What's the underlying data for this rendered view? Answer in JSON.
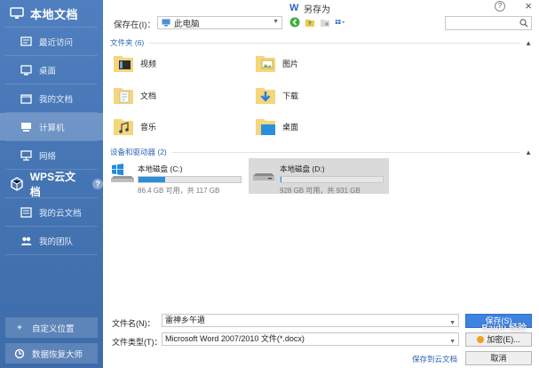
{
  "sidebar": {
    "local_docs_header": "本地文档",
    "local_items": [
      {
        "label": "最近访问",
        "icon": "recent-icon"
      },
      {
        "label": "桌面",
        "icon": "desktop-icon"
      },
      {
        "label": "我的文档",
        "icon": "documents-icon"
      },
      {
        "label": "计算机",
        "icon": "computer-icon"
      },
      {
        "label": "网络",
        "icon": "network-icon"
      }
    ],
    "cloud_header": "WPS云文档",
    "help_label": "?",
    "cloud_items": [
      {
        "label": "我的云文档",
        "icon": "cloud-doc-icon"
      },
      {
        "label": "我的团队",
        "icon": "team-icon"
      }
    ],
    "custom_location_button": "自定义位置",
    "data_recovery_button": "数据恢复大师"
  },
  "window": {
    "title": "另存为",
    "help_label": "?",
    "close_label": "×"
  },
  "location": {
    "label": "保存在(I)：",
    "value": "此电脑"
  },
  "content": {
    "folders_header": "文件夹 (6)",
    "folders": [
      {
        "label": "视频",
        "icon": "video-folder-icon"
      },
      {
        "label": "图片",
        "icon": "pictures-folder-icon"
      },
      {
        "label": "文档",
        "icon": "documents-folder-icon"
      },
      {
        "label": "下载",
        "icon": "downloads-folder-icon"
      },
      {
        "label": "音乐",
        "icon": "music-folder-icon"
      },
      {
        "label": "桌面",
        "icon": "desktop-folder-icon"
      }
    ],
    "devices_header": "设备和驱动器 (2)",
    "drives": [
      {
        "name": "本地磁盘 (C:)",
        "free_text": "86.4 GB 可用，共 117 GB",
        "used_fraction": 0.26,
        "icon": "windows-drive-icon",
        "selected": false
      },
      {
        "name": "本地磁盘 (D:)",
        "free_text": "928 GB 可用，共 931 GB",
        "used_fraction": 0.003,
        "icon": "hard-drive-icon",
        "selected": true
      }
    ]
  },
  "form": {
    "filename_label": "文件名(N)：",
    "filename_value": "雷神乡午遁",
    "filetype_label": "文件类型(T)：",
    "filetype_value": "Microsoft Word 2007/2010 文件(*.docx)",
    "save_to_cloud_link": "保存到云文档",
    "save_button": "保存(S)",
    "encrypt_button": "加密(E)...",
    "cancel_button": "取消"
  },
  "watermark": "Baidu 经验",
  "colors": {
    "sidebar": "#4676b5",
    "accent": "#2d63b4",
    "primary_button": "#3f82e0",
    "drive_bar": "#2d8fd6"
  }
}
